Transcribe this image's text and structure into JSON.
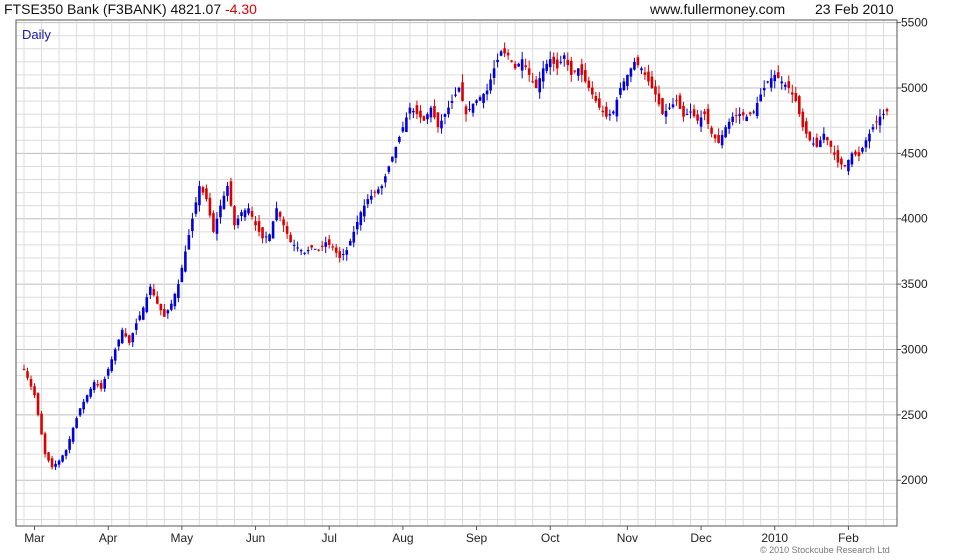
{
  "header": {
    "instrument": "FTSE350 Bank (F3BANK)",
    "last": "4821.07",
    "change": "-4.30",
    "site": "www.fullermoney.com",
    "date": "23 Feb 2010"
  },
  "period_label": "Daily",
  "copyright": "© 2010 Stockcube Research Ltd",
  "colors": {
    "up": "#0000dd",
    "down": "#dd0000",
    "grid": "#dcdcdc",
    "frame": "#555555"
  },
  "chart_data": {
    "type": "candlestick",
    "title": "FTSE350 Bank (F3BANK)",
    "xlabel": "",
    "ylabel": "",
    "ylim": [
      1650,
      5520
    ],
    "y_ticks": [
      2000,
      2500,
      3000,
      3500,
      4000,
      4500,
      5000,
      5500
    ],
    "x_ticks": [
      {
        "label": "Mar",
        "index": 3
      },
      {
        "label": "Apr",
        "index": 24
      },
      {
        "label": "May",
        "index": 45
      },
      {
        "label": "Jun",
        "index": 66
      },
      {
        "label": "Jul",
        "index": 87
      },
      {
        "label": "Aug",
        "index": 108
      },
      {
        "label": "Sep",
        "index": 129
      },
      {
        "label": "Oct",
        "index": 150
      },
      {
        "label": "Nov",
        "index": 172
      },
      {
        "label": "Dec",
        "index": 193
      },
      {
        "label": "2010",
        "index": 214
      },
      {
        "label": "Feb",
        "index": 235
      }
    ],
    "grid": true,
    "legend": "none",
    "series": [
      {
        "close_points": [
          [
            0,
            2850
          ],
          [
            3,
            2650
          ],
          [
            6,
            2200
          ],
          [
            8,
            2100
          ],
          [
            10,
            2150
          ],
          [
            12,
            2230
          ],
          [
            14,
            2400
          ],
          [
            16,
            2550
          ],
          [
            18,
            2650
          ],
          [
            20,
            2750
          ],
          [
            22,
            2700
          ],
          [
            24,
            2850
          ],
          [
            26,
            3000
          ],
          [
            28,
            3150
          ],
          [
            30,
            3050
          ],
          [
            32,
            3200
          ],
          [
            34,
            3320
          ],
          [
            36,
            3480
          ],
          [
            38,
            3350
          ],
          [
            40,
            3250
          ],
          [
            42,
            3350
          ],
          [
            44,
            3500
          ],
          [
            46,
            3750
          ],
          [
            48,
            4000
          ],
          [
            50,
            4250
          ],
          [
            52,
            4150
          ],
          [
            54,
            3900
          ],
          [
            56,
            4100
          ],
          [
            58,
            4250
          ],
          [
            60,
            3950
          ],
          [
            62,
            4050
          ],
          [
            64,
            4080
          ],
          [
            66,
            3950
          ],
          [
            68,
            3850
          ],
          [
            70,
            3880
          ],
          [
            72,
            4080
          ],
          [
            74,
            3950
          ],
          [
            76,
            3820
          ],
          [
            78,
            3780
          ],
          [
            80,
            3740
          ],
          [
            82,
            3780
          ],
          [
            84,
            3760
          ],
          [
            86,
            3820
          ],
          [
            88,
            3780
          ],
          [
            90,
            3700
          ],
          [
            92,
            3760
          ],
          [
            94,
            3900
          ],
          [
            96,
            4050
          ],
          [
            98,
            4150
          ],
          [
            100,
            4200
          ],
          [
            102,
            4250
          ],
          [
            104,
            4400
          ],
          [
            106,
            4550
          ],
          [
            108,
            4700
          ],
          [
            110,
            4850
          ],
          [
            112,
            4800
          ],
          [
            114,
            4750
          ],
          [
            116,
            4850
          ],
          [
            118,
            4700
          ],
          [
            120,
            4800
          ],
          [
            122,
            4900
          ],
          [
            124,
            5000
          ],
          [
            126,
            4800
          ],
          [
            128,
            4880
          ],
          [
            130,
            4930
          ],
          [
            132,
            4980
          ],
          [
            134,
            5150
          ],
          [
            136,
            5280
          ],
          [
            138,
            5250
          ],
          [
            140,
            5150
          ],
          [
            142,
            5220
          ],
          [
            144,
            5100
          ],
          [
            146,
            5000
          ],
          [
            148,
            5150
          ],
          [
            150,
            5220
          ],
          [
            152,
            5150
          ],
          [
            154,
            5250
          ],
          [
            156,
            5100
          ],
          [
            158,
            5150
          ],
          [
            160,
            5050
          ],
          [
            162,
            4950
          ],
          [
            164,
            4850
          ],
          [
            166,
            4780
          ],
          [
            168,
            4820
          ],
          [
            170,
            5000
          ],
          [
            172,
            5100
          ],
          [
            174,
            5200
          ],
          [
            176,
            5150
          ],
          [
            178,
            5050
          ],
          [
            180,
            4950
          ],
          [
            182,
            4800
          ],
          [
            184,
            4850
          ],
          [
            186,
            4900
          ],
          [
            188,
            4780
          ],
          [
            190,
            4820
          ],
          [
            192,
            4750
          ],
          [
            194,
            4800
          ],
          [
            196,
            4650
          ],
          [
            198,
            4580
          ],
          [
            200,
            4700
          ],
          [
            202,
            4780
          ],
          [
            204,
            4800
          ],
          [
            206,
            4780
          ],
          [
            208,
            4820
          ],
          [
            210,
            4950
          ],
          [
            212,
            5050
          ],
          [
            214,
            5100
          ],
          [
            216,
            5050
          ],
          [
            218,
            5000
          ],
          [
            220,
            4900
          ],
          [
            222,
            4700
          ],
          [
            224,
            4600
          ],
          [
            226,
            4550
          ],
          [
            228,
            4650
          ],
          [
            230,
            4550
          ],
          [
            232,
            4430
          ],
          [
            234,
            4400
          ],
          [
            236,
            4500
          ],
          [
            238,
            4480
          ],
          [
            240,
            4600
          ],
          [
            242,
            4700
          ],
          [
            244,
            4780
          ],
          [
            246,
            4821
          ]
        ]
      }
    ]
  }
}
